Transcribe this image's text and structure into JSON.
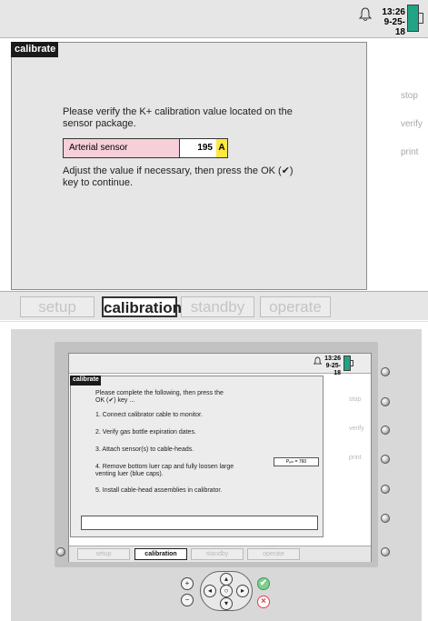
{
  "top": {
    "status": {
      "time": "13:26",
      "date": "9-25-18"
    },
    "panel": {
      "title": "calibrate",
      "instruction": "Please verify the K+ calibration value located on the sensor package.",
      "sensor": {
        "name": "Arterial sensor",
        "value": "195",
        "unit": "A"
      },
      "adjust_text": "Adjust the value if necessary, then press the OK (✔) key to continue."
    },
    "softkeys": [
      "stop",
      "verify",
      "print"
    ],
    "tabs": [
      "setup",
      "calibration",
      "standby",
      "operate"
    ],
    "active_tab": "calibration"
  },
  "device": {
    "status": {
      "time": "13:26",
      "date": "9-25-18"
    },
    "panel": {
      "title": "calibrate",
      "intro": "Please complete the following, then press the OK (✔) key ...",
      "steps": [
        "1. Connect calibrator cable to monitor.",
        "2. Verify gas bottle expiration dates.",
        "3. Attach sensor(s) to cable-heads.",
        "4. Remove bottom luer cap and fully loosen large venting luer (blue caps).",
        "5. Install cable-head assemblies in calibrator."
      ],
      "inset": "Pₑₘ = 760"
    },
    "softkeys": [
      "stop",
      "verify",
      "print"
    ],
    "tabs": [
      "setup",
      "calibration",
      "standby",
      "operate"
    ],
    "active_tab": "calibration",
    "controls": {
      "plus_icon": "plus-icon",
      "minus_icon": "minus-icon",
      "ok_icon": "check-icon",
      "cancel_icon": "cancel-icon",
      "arrow_icons": [
        "up-arrow-icon",
        "left-arrow-icon",
        "ok-center-icon",
        "right-arrow-icon",
        "down-arrow-icon"
      ]
    }
  }
}
